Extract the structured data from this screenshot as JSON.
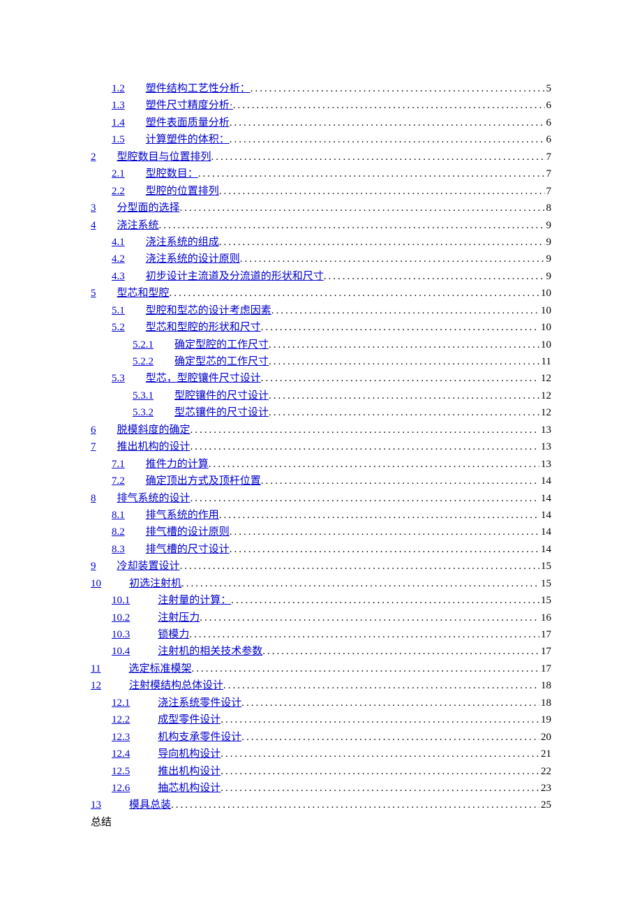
{
  "toc": [
    {
      "level": 1,
      "num": "1.2",
      "gap": "gap-m",
      "title": "塑件结构工艺性分析：",
      "page": "5"
    },
    {
      "level": 1,
      "num": "1.3",
      "gap": "gap-m",
      "title": "塑件尺寸精度分析·",
      "page": "6"
    },
    {
      "level": 1,
      "num": "1.4",
      "gap": "gap-m",
      "title": "塑件表面质量分析",
      "page": "6"
    },
    {
      "level": 1,
      "num": "1.5",
      "gap": "gap-m",
      "title": "计算塑件的体积：",
      "page": "6"
    },
    {
      "level": 0,
      "num": "2",
      "gap": "gap-m",
      "title": "型腔数目与位置排列",
      "page": "7"
    },
    {
      "level": 1,
      "num": "2.1",
      "gap": "gap-m",
      "title": "型腔数目：",
      "page": "7"
    },
    {
      "level": 1,
      "num": "2.2",
      "gap": "gap-m",
      "title": "型腔的位置排列",
      "page": "7"
    },
    {
      "level": 0,
      "num": "3",
      "gap": "gap-m",
      "title": "分型面的选择",
      "page": "8"
    },
    {
      "level": 0,
      "num": "4",
      "gap": "gap-m",
      "title": "浇注系统",
      "page": "9"
    },
    {
      "level": 1,
      "num": "4.1",
      "gap": "gap-m",
      "title": "浇注系统的组成",
      "page": "9"
    },
    {
      "level": 1,
      "num": "4.2",
      "gap": "gap-m",
      "title": "浇注系统的设计原则",
      "page": "9"
    },
    {
      "level": 1,
      "num": "4.3",
      "gap": "gap-m",
      "title": "初步设计主流道及分流道的形状和尺寸",
      "page": "9"
    },
    {
      "level": 0,
      "num": "5",
      "gap": "gap-m",
      "title": "型芯和型腔",
      "page": "10"
    },
    {
      "level": 1,
      "num": "5.1",
      "gap": "gap-m",
      "title": "型腔和型芯的设计考虑因素",
      "page": "10"
    },
    {
      "level": 1,
      "num": "5.2",
      "gap": "gap-m",
      "title": "型芯和型腔的形状和尺寸",
      "page": "10"
    },
    {
      "level": 2,
      "num": "5.2.1",
      "gap": "gap-m",
      "title": "确定型腔的工作尺寸",
      "page": "10"
    },
    {
      "level": 2,
      "num": "5.2.2",
      "gap": "gap-m",
      "title": "确定型芯的工作尺寸",
      "page": "11"
    },
    {
      "level": 1,
      "num": "5.3",
      "gap": "gap-m",
      "title": "型芯，型腔镶件尺寸设计",
      "page": "12"
    },
    {
      "level": 2,
      "num": "5.3.1",
      "gap": "gap-m",
      "title": "型腔镶件的尺寸设计",
      "page": "12"
    },
    {
      "level": 2,
      "num": "5.3.2",
      "gap": "gap-m",
      "title": "型芯镶件的尺寸设计",
      "page": "12"
    },
    {
      "level": 0,
      "num": "6",
      "gap": "gap-m",
      "title": "脱模斜度的确定",
      "page": "13"
    },
    {
      "level": 0,
      "num": "7",
      "gap": "gap-m",
      "title": "推出机构的设计",
      "page": "13"
    },
    {
      "level": 1,
      "num": "7.1",
      "gap": "gap-m",
      "title": "推件力的计算",
      "page": "13"
    },
    {
      "level": 1,
      "num": "7.2",
      "gap": "gap-m",
      "title": "确定顶出方式及顶杆位置",
      "page": "14"
    },
    {
      "level": 0,
      "num": "8",
      "gap": "gap-m",
      "title": "排气系统的设计",
      "page": "14"
    },
    {
      "level": 1,
      "num": "8.1",
      "gap": "gap-m",
      "title": "排气系统的作用",
      "page": "14"
    },
    {
      "level": 1,
      "num": "8.2",
      "gap": "gap-m",
      "title": "排气槽的设计原则",
      "page": "14"
    },
    {
      "level": 1,
      "num": "8.3",
      "gap": "gap-m",
      "title": "排气槽的尺寸设计",
      "page": "14"
    },
    {
      "level": 0,
      "num": "9",
      "gap": "gap-m",
      "title": "冷却装置设计",
      "page": "15"
    },
    {
      "level": 0,
      "num": "10",
      "gap": "gap-l",
      "title": "初选注射机",
      "page": "15"
    },
    {
      "level": 1,
      "num": "10.1",
      "gap": "gap-l",
      "title": "注射量的计算：",
      "page": "15"
    },
    {
      "level": 1,
      "num": "10.2",
      "gap": "gap-l",
      "title": "注射压力",
      "page": "16"
    },
    {
      "level": 1,
      "num": "10.3",
      "gap": "gap-l",
      "title": "锁模力",
      "page": "17"
    },
    {
      "level": 1,
      "num": "10.4",
      "gap": "gap-l",
      "title": "注射机的相关技术参数",
      "page": "17"
    },
    {
      "level": 0,
      "num": "11",
      "gap": "gap-l",
      "title": "选定标准模架",
      "page": "17"
    },
    {
      "level": 0,
      "num": "12",
      "gap": "gap-l",
      "title": "注射模结构总体设计",
      "page": "18"
    },
    {
      "level": 1,
      "num": "12.1",
      "gap": "gap-l",
      "title": "浇注系统零件设计",
      "page": "18"
    },
    {
      "level": 1,
      "num": "12.2",
      "gap": "gap-l",
      "title": "成型零件设计",
      "page": "19"
    },
    {
      "level": 1,
      "num": "12.3",
      "gap": "gap-l",
      "title": "机构支承零件设计",
      "page": "20"
    },
    {
      "level": 1,
      "num": "12.4",
      "gap": "gap-l",
      "title": "导向机构设计",
      "page": "21"
    },
    {
      "level": 1,
      "num": "12.5",
      "gap": "gap-l",
      "title": "推出机构设计",
      "page": "22"
    },
    {
      "level": 1,
      "num": "12.6",
      "gap": "gap-l",
      "title": "抽芯机构设计",
      "page": "23"
    },
    {
      "level": 0,
      "num": "13",
      "gap": "gap-l",
      "title": "模具总装",
      "page": "25"
    }
  ],
  "final_text": "总结"
}
